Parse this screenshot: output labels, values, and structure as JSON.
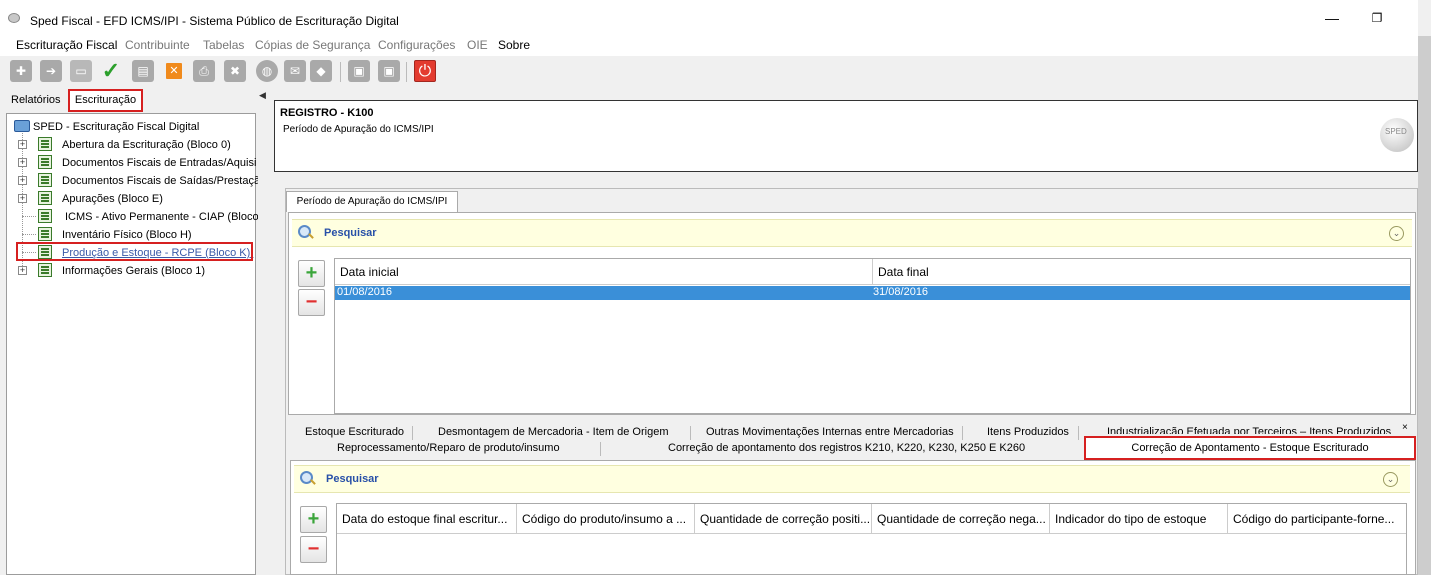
{
  "window": {
    "title": "Sped Fiscal - EFD ICMS/IPI - Sistema Público de Escrituração Digital",
    "minimize": "—",
    "maximize": "❐"
  },
  "menu": [
    {
      "label": "Escrituração Fiscal",
      "enabled": true
    },
    {
      "label": "Contribuinte",
      "enabled": false
    },
    {
      "label": "Tabelas",
      "enabled": false
    },
    {
      "label": "Cópias de Segurança",
      "enabled": false
    },
    {
      "label": "Configurações",
      "enabled": false
    },
    {
      "label": "OIE",
      "enabled": false
    },
    {
      "label": "Sobre",
      "enabled": true
    }
  ],
  "toolbar": {
    "icons": [
      "new-file-icon",
      "import-icon",
      "open-folder-icon",
      "validate-check-icon",
      "sign-icon",
      "delete-icon",
      "print-icon",
      "remove-icon",
      "globe-icon",
      "mail-icon",
      "shield-icon",
      "save-icon",
      "save-as-icon",
      "power-icon"
    ]
  },
  "left_tabs": {
    "relatorios": "Relatórios",
    "escrituracao": "Escrituração"
  },
  "tree": {
    "root": "SPED - Escrituração Fiscal Digital",
    "items": [
      {
        "label": "Abertura da Escrituração (Bloco 0)",
        "expandable": true
      },
      {
        "label": "Documentos Fiscais de Entradas/Aquisi",
        "expandable": true
      },
      {
        "label": "Documentos Fiscais de Saídas/Prestaçã",
        "expandable": true
      },
      {
        "label": "Apurações (Bloco E)",
        "expandable": true
      },
      {
        "label": "ICMS - Ativo Permanente - CIAP (Bloco",
        "expandable": false
      },
      {
        "label": "Inventário Físico (Bloco H)",
        "expandable": false
      },
      {
        "label": "Produção e Estoque - RCPE (Bloco K).",
        "expandable": false
      },
      {
        "label": "Informações Gerais (Bloco 1)",
        "expandable": true
      }
    ]
  },
  "header": {
    "title": "REGISTRO - K100",
    "subtitle": "Período de Apuração do ICMS/IPI",
    "logo_text": "SPED"
  },
  "main_tab": "Período de Apuração do ICMS/IPI",
  "search_label": "Pesquisar",
  "chevron": "⌄",
  "add_label": "+",
  "remove_label": "−",
  "grid1": {
    "columns": [
      "Data inicial",
      "Data final"
    ],
    "rows": [
      [
        "01/08/2016",
        "31/08/2016"
      ]
    ]
  },
  "lower_tabs": {
    "row1": [
      "Estoque Escriturado",
      "Desmontagem de Mercadoria - Item de Origem",
      "Outras Movimentações Internas entre Mercadorias",
      "Itens Produzidos",
      "Industrialização Efetuada por Terceiros – Itens Produzidos"
    ],
    "row2": [
      "Reprocessamento/Reparo de produto/insumo",
      "Correção de apontamento dos registros K210, K220, K230, K250 E K260",
      "Correção de Apontamento - Estoque Escriturado"
    ],
    "close": "×"
  },
  "grid2": {
    "columns": [
      "Data do estoque final escritur...",
      "Código do produto/insumo a ...",
      "Quantidade de correção positi...",
      "Quantidade de correção nega...",
      "Indicador do tipo de estoque",
      "Código do participante-forne..."
    ]
  }
}
